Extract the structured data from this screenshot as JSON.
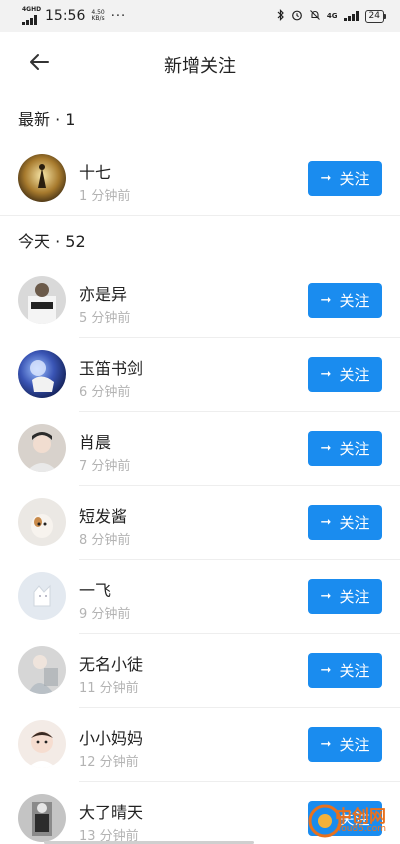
{
  "status_bar": {
    "network_tag": "4GHD",
    "time": "15:56",
    "speed_value": "4.50",
    "speed_unit": "KB/s",
    "more": "···",
    "right_network": "4G",
    "battery": "24",
    "icons": [
      "signal-icon",
      "bluetooth-icon",
      "alarm-icon",
      "mute-icon",
      "battery-icon"
    ]
  },
  "nav": {
    "back_icon": "arrow-left-icon",
    "title": "新增关注"
  },
  "sections": [
    {
      "title": "最新 · 1",
      "items": [
        {
          "name": "十七",
          "time": "1 分钟前",
          "button": "关注",
          "avatar_color": "#b08a3c"
        }
      ]
    },
    {
      "title": "今天 · 52",
      "items": [
        {
          "name": "亦是异",
          "time": "5 分钟前",
          "button": "关注",
          "avatar_color": "#cfcfcf"
        },
        {
          "name": "玉笛书剑",
          "time": "6 分钟前",
          "button": "关注",
          "avatar_color": "#2b3f8f"
        },
        {
          "name": "肖晨",
          "time": "7 分钟前",
          "button": "关注",
          "avatar_color": "#d8d2cc"
        },
        {
          "name": "短发酱",
          "time": "8 分钟前",
          "button": "关注",
          "avatar_color": "#e7e3df"
        },
        {
          "name": "一飞",
          "time": "9 分钟前",
          "button": "关注",
          "avatar_color": "#dfe6ee"
        },
        {
          "name": "无名小徒",
          "time": "11 分钟前",
          "button": "关注",
          "avatar_color": "#c9c9c9"
        },
        {
          "name": "小小妈妈",
          "time": "12 分钟前",
          "button": "关注",
          "avatar_color": "#f3e7e0"
        },
        {
          "name": "大了晴天",
          "time": "13 分钟前",
          "button": "关注",
          "avatar_color": "#bdbdbd"
        }
      ]
    }
  ],
  "watermark": {
    "title": "中创网",
    "sub": "You85.com"
  },
  "colors": {
    "accent": "#1a8cef",
    "secondary_text": "#b3b3b3"
  }
}
